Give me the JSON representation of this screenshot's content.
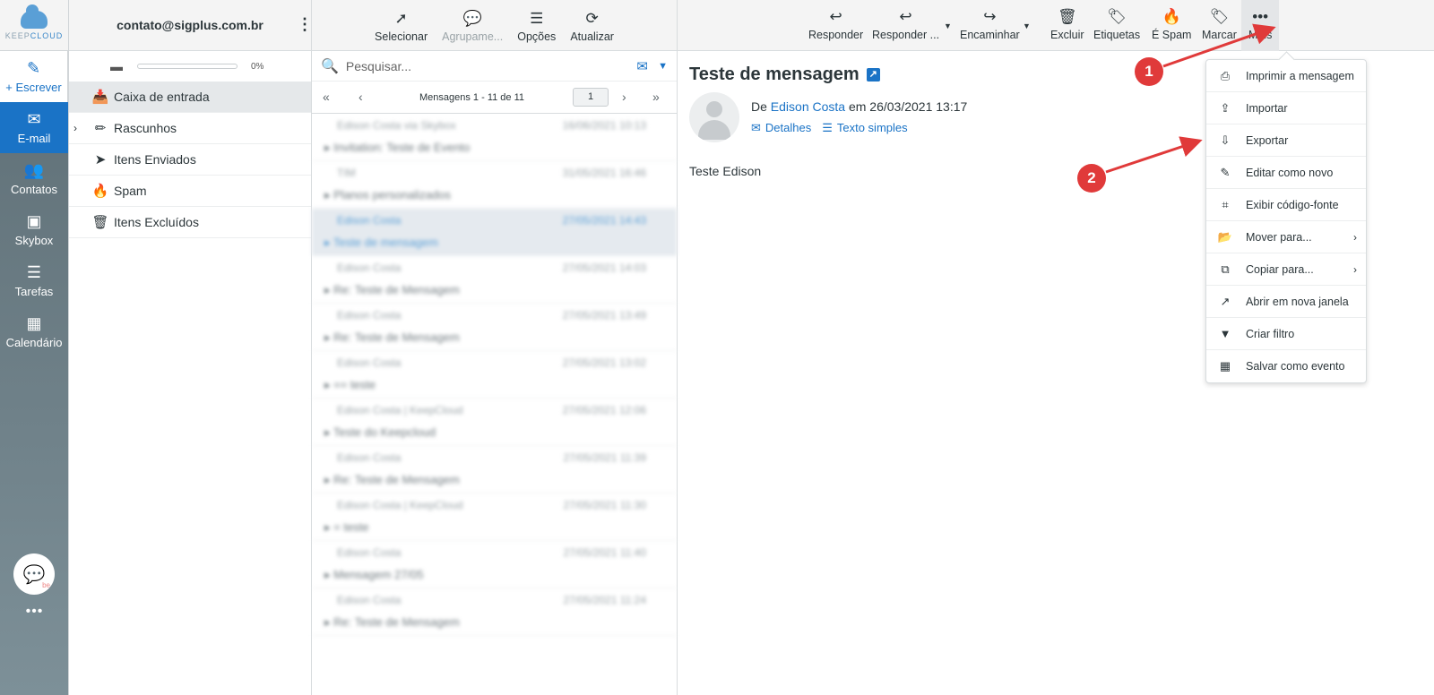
{
  "rail": {
    "logo_brand_a": "KEEP",
    "logo_brand_b": "CLOUD",
    "compose": "+ Escrever",
    "items": [
      {
        "label": "E-mail"
      },
      {
        "label": "Contatos"
      },
      {
        "label": "Skybox"
      },
      {
        "label": "Tarefas"
      },
      {
        "label": "Calendário"
      }
    ],
    "chat_badge": "be"
  },
  "account": {
    "email": "contato@sigplus.com.br",
    "quota_percent": "0%",
    "quota_fraction": 0
  },
  "folders": [
    {
      "label": "Caixa de entrada"
    },
    {
      "label": "Rascunhos"
    },
    {
      "label": "Itens Enviados"
    },
    {
      "label": "Spam"
    },
    {
      "label": "Itens Excluídos"
    }
  ],
  "list_toolbar": {
    "select": "Selecionar",
    "group": "Agrupame...",
    "options": "Opções",
    "refresh": "Atualizar"
  },
  "search": {
    "placeholder": "Pesquisar..."
  },
  "pager": {
    "label": "Mensagens 1 - 11 de 11",
    "page": "1"
  },
  "messages": [
    {
      "from": "Edison Costa via Skybox",
      "date": "16/06/2021 10:13",
      "subject": "Invitation: Teste de Evento"
    },
    {
      "from": "TIM",
      "date": "31/05/2021 16:46",
      "subject": "Planos personalizados"
    },
    {
      "from": "Edison Costa",
      "date": "27/05/2021 14:43",
      "subject": "Teste de mensagem"
    },
    {
      "from": "Edison Costa",
      "date": "27/05/2021 14:03",
      "subject": "Re: Teste de Mensagem"
    },
    {
      "from": "Edison Costa",
      "date": "27/05/2021 13:49",
      "subject": "Re: Teste de Mensagem"
    },
    {
      "from": "Edison Costa",
      "date": "27/05/2021 13:02",
      "subject": "== teste"
    },
    {
      "from": "Edison Costa | KeepCloud",
      "date": "27/05/2021 12:06",
      "subject": "Teste do Keepcloud"
    },
    {
      "from": "Edison Costa",
      "date": "27/05/2021 11:39",
      "subject": "Re: Teste de Mensagem"
    },
    {
      "from": "Edison Costa | KeepCloud",
      "date": "27/05/2021 11:30",
      "subject": "= teste"
    },
    {
      "from": "Edison Costa",
      "date": "27/05/2021 11:40",
      "subject": "Mensagem 27/05"
    },
    {
      "from": "Edison Costa",
      "date": "27/05/2021 11:24",
      "subject": "Re: Teste de Mensagem"
    }
  ],
  "reader_toolbar": {
    "reply": "Responder",
    "reply_all": "Responder ...",
    "forward": "Encaminhar",
    "delete": "Excluir",
    "tags": "Etiquetas",
    "spam": "É Spam",
    "mark": "Marcar",
    "more": "Mais"
  },
  "message": {
    "subject": "Teste de mensagem",
    "from_prefix": "De",
    "from_name": "Edison Costa",
    "date_text": "em 26/03/2021 13:17",
    "details": "Detalhes",
    "plain_text": "Texto simples",
    "body": "Teste Edison"
  },
  "more_menu": [
    {
      "label": "Imprimir a mensagem",
      "icon": "printer-icon"
    },
    {
      "label": "Importar",
      "icon": "upload-icon"
    },
    {
      "label": "Exportar",
      "icon": "download-icon"
    },
    {
      "label": "Editar como novo",
      "icon": "pencil-icon"
    },
    {
      "label": "Exibir código-fonte",
      "icon": "source-icon"
    },
    {
      "label": "Mover para...",
      "icon": "folder-open-icon"
    },
    {
      "label": "Copiar para...",
      "icon": "copy-icon"
    },
    {
      "label": "Abrir em nova janela",
      "icon": "external-icon"
    },
    {
      "label": "Criar filtro",
      "icon": "filter-icon"
    },
    {
      "label": "Salvar como evento",
      "icon": "calendar-icon"
    }
  ],
  "annotations": {
    "step1": "1",
    "step2": "2",
    "color": "#e03a3a"
  }
}
